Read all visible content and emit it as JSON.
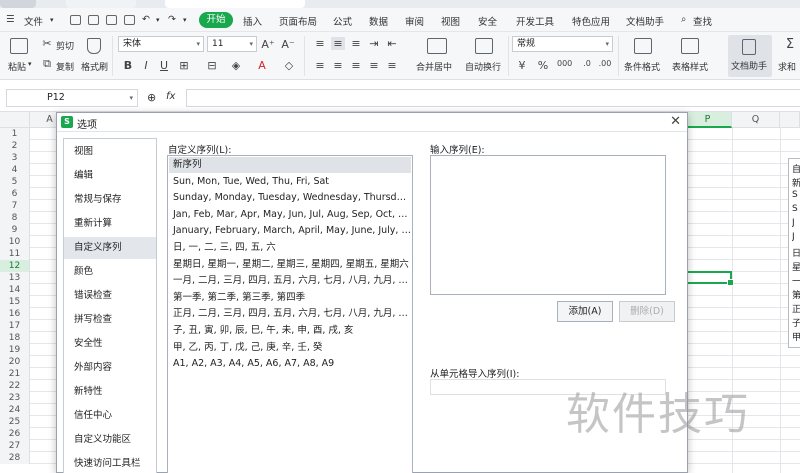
{
  "menubar": {
    "file": "文件",
    "items": [
      "开始",
      "插入",
      "页面布局",
      "公式",
      "数据",
      "审阅",
      "视图",
      "安全",
      "开发工具",
      "特色应用",
      "文档助手"
    ],
    "search": "查找"
  },
  "ribbon": {
    "paste": "粘贴",
    "cut": "剪切",
    "copy": "复制",
    "format_painter": "格式刷",
    "font_name": "宋体",
    "font_size": "11",
    "merge_center": "合并居中",
    "wrap_text": "自动换行",
    "number_format": "常规",
    "conditional_format": "条件格式",
    "table_style": "表格样式",
    "doc_assistant": "文档助手",
    "sum": "求和"
  },
  "formula_bar": {
    "cell_ref": "P12",
    "fx": "fx"
  },
  "sheet": {
    "columns": [
      "A",
      "P",
      "Q"
    ],
    "rows": [
      "1",
      "2",
      "3",
      "4",
      "5",
      "6",
      "7",
      "8",
      "9",
      "10",
      "11",
      "12",
      "13",
      "14",
      "15",
      "16",
      "17",
      "18",
      "19",
      "20",
      "21",
      "22",
      "23",
      "24",
      "25",
      "26",
      "27",
      "28"
    ],
    "active_row": "12",
    "active_column": "P"
  },
  "bg_panel": [
    "自",
    "新",
    "S",
    "S",
    "J",
    "J",
    "日",
    "星",
    "一",
    "第",
    "正",
    "子",
    "甲"
  ],
  "dialog": {
    "title": "选项",
    "nav": [
      "视图",
      "编辑",
      "常规与保存",
      "重新计算",
      "自定义序列",
      "颜色",
      "错误检查",
      "拼写检查",
      "安全性",
      "外部内容",
      "新特性",
      "信任中心",
      "自定义功能区",
      "快速访问工具栏"
    ],
    "selected_nav": "自定义序列",
    "custom_lists_label": "自定义序列(L):",
    "custom_lists": [
      "新序列",
      "Sun, Mon, Tue, Wed, Thu, Fri, Sat",
      "Sunday, Monday, Tuesday, Wednesday, Thursday, Friday, Saturday",
      "Jan, Feb, Mar, Apr, May, Jun, Jul, Aug, Sep, Oct, Nov, Dec",
      "January, February, March, April, May, June, July, August, September, October, November, December",
      "日, 一, 二, 三, 四, 五, 六",
      "星期日, 星期一, 星期二, 星期三, 星期四, 星期五, 星期六",
      "一月, 二月, 三月, 四月, 五月, 六月, 七月, 八月, 九月, 十月, 十一月, 十二月",
      "第一季, 第二季, 第三季, 第四季",
      "正月, 二月, 三月, 四月, 五月, 六月, 七月, 八月, 九月, 十月, 十一月, 腊月",
      "子, 丑, 寅, 卯, 辰, 巳, 午, 未, 申, 酉, 戌, 亥",
      "甲, 乙, 丙, 丁, 戊, 己, 庚, 辛, 壬, 癸",
      "A1, A2, A3, A4, A5, A6, A7, A8, A9"
    ],
    "input_list_label": "输入序列(E):",
    "add_button": "添加(A)",
    "delete_button": "删除(D)",
    "import_label": "从单元格导入序列(I):"
  },
  "watermark": "软件技巧",
  "colors": {
    "accent": "#1aa84e",
    "selection": "#dfe3e8"
  }
}
